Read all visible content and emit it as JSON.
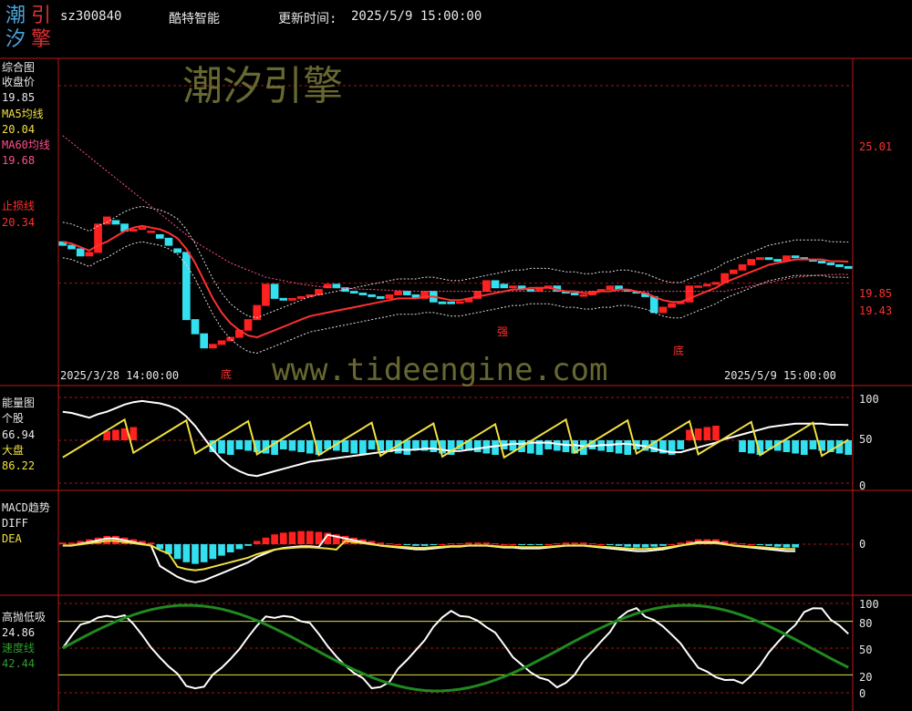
{
  "header": {
    "logo_chars": [
      "潮",
      "引",
      "汐",
      "擎"
    ],
    "code": "sz300840",
    "name": "酷特智能",
    "update_label": "更新时间:",
    "update_time": "2025/5/9 15:00:00"
  },
  "watermarks": {
    "brand": "潮汐引擎",
    "url": "www.tideengine.com"
  },
  "colors": {
    "up": "#ff2020",
    "down": "#33e0f0",
    "ma5": "#f0e040",
    "ma60": "#ff5088",
    "stop": "#ff3030",
    "frame": "#c01818",
    "white": "#ffffff",
    "speed": "#1f8a1f"
  },
  "panels": {
    "main": {
      "title": "综合图",
      "close_label": "收盘价",
      "close_value": "19.85",
      "ma5_label": "MA5均线",
      "ma5_value": "20.04",
      "ma60_label": "MA60均线",
      "ma60_value": "19.68",
      "stop_label": "止损线",
      "stop_value": "20.34",
      "right_ticks": [
        "25.01",
        "19.85",
        "19.43"
      ],
      "start_time": "2025/3/28 14:00:00",
      "end_time": "2025/5/9 15:00:00",
      "markers": [
        "底",
        "强",
        "底"
      ]
    },
    "energy": {
      "title": "能量图",
      "stock_label": "个股",
      "stock_value": "66.94",
      "market_label": "大盘",
      "market_value": "86.22",
      "right_ticks": [
        "100",
        "50",
        "0"
      ]
    },
    "macd": {
      "title": "MACD趋势",
      "diff_label": "DIFF",
      "dea_label": "DEA",
      "right_ticks": [
        "0"
      ]
    },
    "oscillator": {
      "title": "高抛低吸",
      "value": "24.86",
      "speed_label": "速度线",
      "speed_value": "42.44",
      "right_ticks": [
        "100",
        "80",
        "50",
        "20",
        "0"
      ]
    }
  },
  "chart_data": {
    "type": "line",
    "bars": [
      [
        20.6,
        20.5
      ],
      [
        20.5,
        20.4
      ],
      [
        20.4,
        20.2
      ],
      [
        20.2,
        20.3
      ],
      [
        20.3,
        21.1
      ],
      [
        21.1,
        21.3
      ],
      [
        21.2,
        21.1
      ],
      [
        21.1,
        20.9
      ],
      [
        20.9,
        20.95
      ],
      [
        20.95,
        21.0
      ],
      [
        20.9,
        20.9
      ],
      [
        20.8,
        20.7
      ],
      [
        20.7,
        20.5
      ],
      [
        20.4,
        20.3
      ],
      [
        20.3,
        18.4
      ],
      [
        18.4,
        18.0
      ],
      [
        18.0,
        17.6
      ],
      [
        17.6,
        17.7
      ],
      [
        17.7,
        17.8
      ],
      [
        17.8,
        17.9
      ],
      [
        17.9,
        18.1
      ],
      [
        18.1,
        18.4
      ],
      [
        18.4,
        18.8
      ],
      [
        18.8,
        19.4
      ],
      [
        19.4,
        19.0
      ],
      [
        19.0,
        18.95
      ],
      [
        18.95,
        19.0
      ],
      [
        19.0,
        19.05
      ],
      [
        19.05,
        19.1
      ],
      [
        19.1,
        19.25
      ],
      [
        19.3,
        19.4
      ],
      [
        19.4,
        19.3
      ],
      [
        19.3,
        19.2
      ],
      [
        19.2,
        19.15
      ],
      [
        19.15,
        19.1
      ],
      [
        19.1,
        19.05
      ],
      [
        19.05,
        19.0
      ],
      [
        19.0,
        19.1
      ],
      [
        19.1,
        19.2
      ],
      [
        19.2,
        19.1
      ],
      [
        19.1,
        19.0
      ],
      [
        19.0,
        19.2
      ],
      [
        19.2,
        18.9
      ],
      [
        18.9,
        18.85
      ],
      [
        18.9,
        18.85
      ],
      [
        18.9,
        18.9
      ],
      [
        18.9,
        19.0
      ],
      [
        19.0,
        19.2
      ],
      [
        19.2,
        19.5
      ],
      [
        19.5,
        19.3
      ],
      [
        19.4,
        19.3
      ],
      [
        19.3,
        19.35
      ],
      [
        19.35,
        19.25
      ],
      [
        19.25,
        19.2
      ],
      [
        19.2,
        19.3
      ],
      [
        19.3,
        19.35
      ],
      [
        19.35,
        19.2
      ],
      [
        19.2,
        19.15
      ],
      [
        19.15,
        19.1
      ],
      [
        19.1,
        19.1
      ],
      [
        19.1,
        19.2
      ],
      [
        19.2,
        19.25
      ],
      [
        19.25,
        19.35
      ],
      [
        19.35,
        19.25
      ],
      [
        19.25,
        19.2
      ],
      [
        19.2,
        19.15
      ],
      [
        19.15,
        19.05
      ],
      [
        19.05,
        18.6
      ],
      [
        18.6,
        18.75
      ],
      [
        18.75,
        18.85
      ],
      [
        18.85,
        18.9
      ],
      [
        18.9,
        19.35
      ],
      [
        19.35,
        19.35
      ],
      [
        19.35,
        19.4
      ],
      [
        19.4,
        19.45
      ],
      [
        19.45,
        19.7
      ],
      [
        19.7,
        19.8
      ],
      [
        19.8,
        19.95
      ],
      [
        19.95,
        20.1
      ],
      [
        20.1,
        20.15
      ],
      [
        20.15,
        20.1
      ],
      [
        20.1,
        20.05
      ],
      [
        20.05,
        20.2
      ],
      [
        20.2,
        20.15
      ],
      [
        20.15,
        20.1
      ],
      [
        20.1,
        20.05
      ],
      [
        20.05,
        20.0
      ],
      [
        20.0,
        19.95
      ],
      [
        19.95,
        19.9
      ],
      [
        19.9,
        19.85
      ]
    ],
    "ma5": [
      20.6,
      20.55,
      20.45,
      20.35,
      20.5,
      20.6,
      20.75,
      20.9,
      21.0,
      21.05,
      21.0,
      20.95,
      20.85,
      20.7,
      20.4,
      20.0,
      19.5,
      19.0,
      18.6,
      18.3,
      18.1,
      17.95,
      17.9,
      18.0,
      18.1,
      18.2,
      18.3,
      18.4,
      18.5,
      18.55,
      18.6,
      18.65,
      18.7,
      18.75,
      18.8,
      18.85,
      18.9,
      18.95,
      19.0,
      19.0,
      19.0,
      19.05,
      19.05,
      19.0,
      18.95,
      18.95,
      19.0,
      19.05,
      19.1,
      19.15,
      19.2,
      19.25,
      19.25,
      19.3,
      19.3,
      19.3,
      19.25,
      19.2,
      19.2,
      19.15,
      19.15,
      19.2,
      19.2,
      19.25,
      19.25,
      19.2,
      19.15,
      19.05,
      18.95,
      18.9,
      18.9,
      19.0,
      19.1,
      19.2,
      19.3,
      19.45,
      19.55,
      19.65,
      19.75,
      19.85,
      19.95,
      20.0,
      20.05,
      20.1,
      20.1,
      20.1,
      20.1,
      20.05,
      20.05,
      20.04
    ],
    "ma60": [
      23.6,
      23.4,
      23.2,
      23.0,
      22.8,
      22.6,
      22.4,
      22.2,
      22.0,
      21.8,
      21.6,
      21.4,
      21.2,
      21.0,
      20.8,
      20.6,
      20.45,
      20.3,
      20.15,
      20.0,
      19.9,
      19.8,
      19.7,
      19.6,
      19.55,
      19.5,
      19.45,
      19.4,
      19.37,
      19.34,
      19.32,
      19.3,
      19.28,
      19.27,
      19.26,
      19.25,
      19.24,
      19.23,
      19.22,
      19.21,
      19.2,
      19.2,
      19.2,
      19.2,
      19.2,
      19.2,
      19.2,
      19.2,
      19.2,
      19.2,
      19.2,
      19.2,
      19.2,
      19.2,
      19.2,
      19.2,
      19.2,
      19.2,
      19.2,
      19.2,
      19.2,
      19.2,
      19.2,
      19.2,
      19.2,
      19.2,
      19.2,
      19.2,
      19.2,
      19.2,
      19.2,
      19.2,
      19.2,
      19.2,
      19.2,
      19.2,
      19.25,
      19.3,
      19.35,
      19.4,
      19.45,
      19.5,
      19.55,
      19.6,
      19.62,
      19.64,
      19.66,
      19.67,
      19.68,
      19.68
    ],
    "energy_bars": [
      0,
      0,
      0,
      0,
      0,
      1,
      1,
      1,
      1,
      0,
      0,
      0,
      0,
      0,
      0,
      0,
      0,
      -1,
      -1,
      -1,
      -1,
      -1,
      -1,
      -1,
      -1,
      -1,
      -1,
      -1,
      -1,
      -1,
      -1,
      -1,
      -1,
      -1,
      -1,
      -1,
      -1,
      -1,
      -1,
      -1,
      -1,
      -1,
      -1,
      -1,
      -1,
      -1,
      -1,
      -1,
      -1,
      -1,
      -1,
      -1,
      -1,
      -1,
      -1,
      -1,
      -1,
      -1,
      -1,
      -1,
      -1,
      -1,
      -1,
      -1,
      -1,
      -1,
      -1,
      -1,
      -1,
      -1,
      -1,
      1,
      1,
      1,
      1,
      0,
      0,
      -1,
      -1,
      -1,
      -1,
      -1,
      -1,
      -1,
      -1,
      -1,
      -1,
      -1,
      -1,
      -1
    ],
    "macd_hist": [
      0.1,
      0.1,
      0.2,
      0.3,
      0.4,
      0.5,
      0.5,
      0.4,
      0.3,
      0.2,
      0.1,
      -0.3,
      -0.6,
      -0.9,
      -1.1,
      -1.2,
      -1.1,
      -0.9,
      -0.7,
      -0.5,
      -0.3,
      -0.1,
      0.2,
      0.4,
      0.6,
      0.7,
      0.75,
      0.8,
      0.8,
      0.75,
      0.7,
      0.6,
      0.5,
      0.4,
      0.3,
      0.2,
      0.1,
      0.05,
      0,
      -0.05,
      -0.1,
      -0.1,
      -0.05,
      0,
      0.05,
      0.05,
      0.1,
      0.1,
      0.1,
      0.05,
      0,
      0,
      -0.05,
      -0.05,
      -0.05,
      0,
      0.05,
      0.1,
      0.1,
      0.1,
      0.05,
      0,
      -0.05,
      -0.1,
      -0.15,
      -0.2,
      -0.2,
      -0.15,
      -0.1,
      0,
      0.1,
      0.2,
      0.3,
      0.3,
      0.3,
      0.2,
      0.1,
      0.05,
      0,
      -0.05,
      -0.1,
      -0.15,
      -0.2,
      -0.2
    ]
  }
}
